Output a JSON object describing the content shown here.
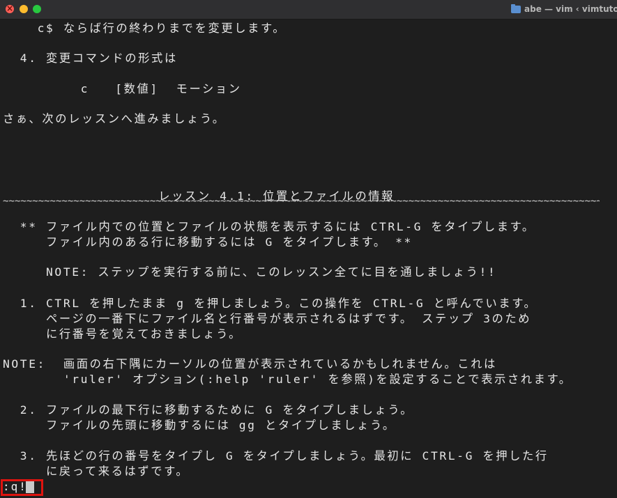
{
  "window": {
    "title": "abe — vim ‹ vimtutor",
    "folder_icon": "folder-icon",
    "traffic_lights": {
      "close": "#ff5f57",
      "minimize": "#febc2e",
      "maximize": "#28c840"
    }
  },
  "terminal": {
    "background": "#1e1e1e",
    "lines": [
      "    c$ ならば行の終わりまでを変更します。",
      "  4. 変更コマンドの形式は",
      "         c   [数値]  モーション",
      "さぁ、次のレッスンへ進みましょう。",
      "                  レッスン 4.1: 位置とファイルの情報",
      "  ** ファイル内での位置とファイルの状態を表示するには CTRL-G をタイプします。",
      "     ファイル内のある行に移動するには G をタイプします。 **",
      "     NOTE: ステップを実行する前に、このレッスン全てに目を通しましょう!!",
      "  1. CTRL を押したまま g を押しましょう。この操作を CTRL-G と呼んでいます。",
      "     ページの一番下にファイル名と行番号が表示されるはずです。 ステップ 3のため",
      "     に行番号を覚えておきましょう。",
      "NOTE:  画面の右下隅にカーソルの位置が表示されているかもしれません。これは",
      "       'ruler' オプション(:help 'ruler' を参照)を設定することで表示されます。",
      "  2. ファイルの最下行に移動するために G をタイプしましょう。",
      "     ファイルの先頭に移動するには gg とタイプしましょう。",
      "  3. 先ほどの行の番号をタイプし G をタイプしましょう。最初に CTRL-G を押した行",
      "     に戻って来るはずです。"
    ],
    "separator": "~~~~~~~~~~~~~~~~~~~~~~~~~~~~~~~~~~~~~~~~~~~~~~~~~~~~~~~~~~~~~~~~~~~~~~~~~~~~~~~~~~~~~~~~~~~~~~~~~~~~~~~~~~~~~~~~~~~~~~~~~~~~~~~~~~~~~~~~~~",
    "command_line": ":q!",
    "highlight_color": "#e0140f"
  }
}
